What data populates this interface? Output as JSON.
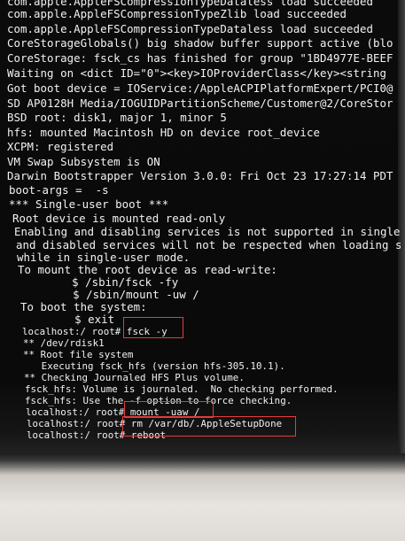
{
  "terminal": {
    "lines": [
      "com.apple.AppleFSCompressionTypeDataless load succeeded",
      "com.apple.AppleFSCompressionTypeZlib load succeeded",
      "com.apple.AppleFSCompressionTypeDataless load succeeded",
      "CoreStorageGlobals() big shadow buffer support active (blo",
      "CoreStorage: fsck_cs has finished for group \"1BD4977E-BEEF",
      "Waiting on <dict ID=\"0\"><key>IOProviderClass</key><string",
      "Got boot device = IOService:/AppleACPIPlatformExpert/PCI0@",
      "SD AP0128H Media/IOGUIDPartitionScheme/Customer@2/CoreStor",
      "BSD root: disk1, major 1, minor 5",
      "hfs: mounted Macintosh HD on device root_device",
      "XCPM: registered",
      "VM Swap Subsystem is ON",
      "Darwin Bootstrapper Version 3.0.0: Fri Oct 23 17:27:14 PDT",
      "boot-args =  -s",
      "*** Single-user boot ***",
      "Root device is mounted read-only",
      "Enabling and disabling services is not supported in single-",
      "and disabled services will not be respected when loading ser",
      "while in single-user mode.",
      "To mount the root device as read-write:",
      "        $ /sbin/fsck -fy",
      "        $ /sbin/mount -uw /",
      "To boot the system:",
      "        $ exit",
      "localhost:/ root# fsck -y",
      "** /dev/rdisk1",
      "** Root file system",
      "   Executing fsck_hfs (version hfs-305.10.1).",
      "** Checking Journaled HFS Plus volume.",
      "fsck_hfs: Volume is journaled.  No checking performed.",
      "fsck_hfs: Use the -f option to force checking.",
      "localhost:/ root# mount -uaw /",
      "localhost:/ root# rm /var/db/.AppleSetupDone",
      "localhost:/ root# reboot"
    ]
  }
}
